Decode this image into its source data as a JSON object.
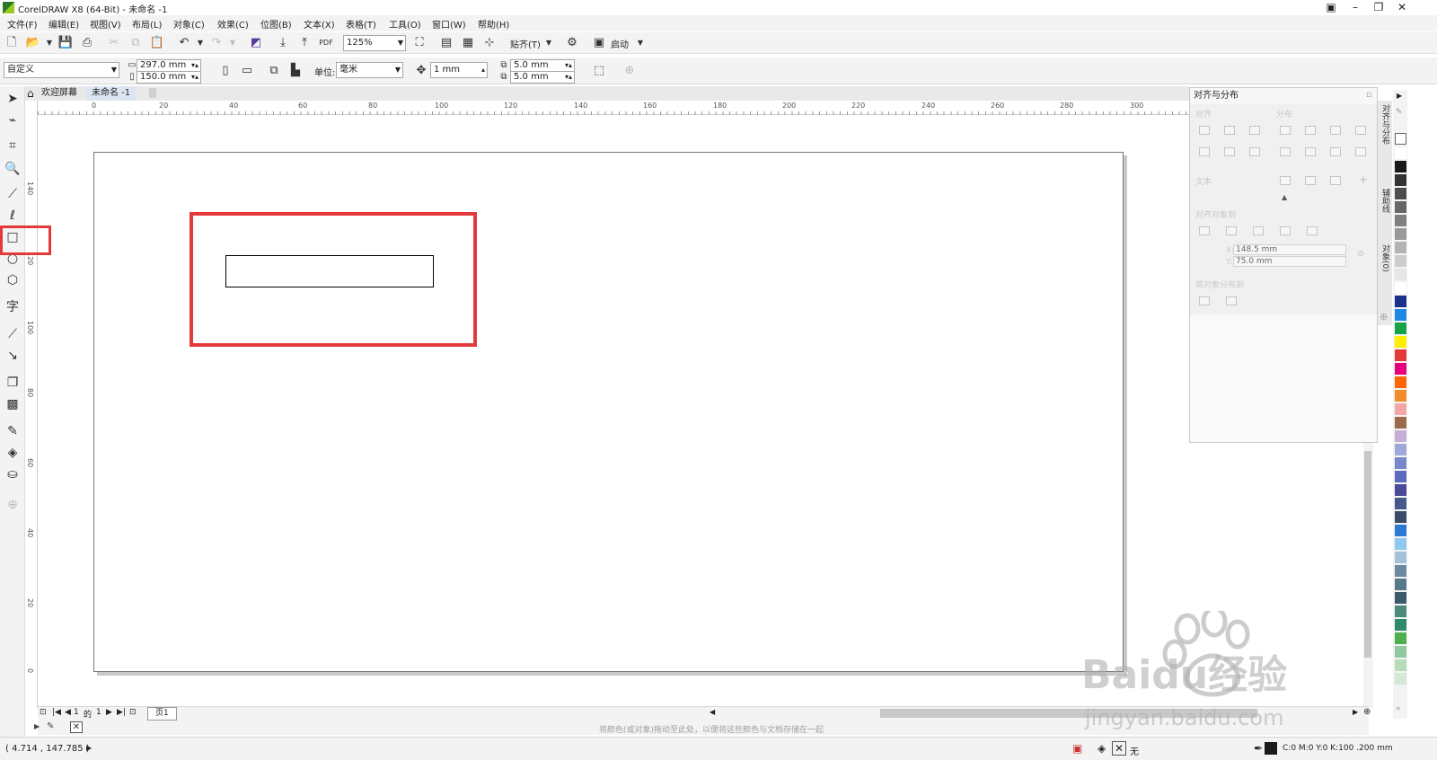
{
  "window": {
    "title": "CorelDRAW X8 (64-Bit) - 未命名 -1",
    "controls": [
      "minimize",
      "restore",
      "close"
    ]
  },
  "menubar": {
    "items": [
      "文件(F)",
      "编辑(E)",
      "视图(V)",
      "布局(L)",
      "对象(C)",
      "效果(C)",
      "位图(B)",
      "文本(X)",
      "表格(T)",
      "工具(O)",
      "窗口(W)",
      "帮助(H)"
    ]
  },
  "standard_toolbar": {
    "zoom_value": "125%",
    "snap_label": "贴齐(T)",
    "launch_label": "启动",
    "pdf_label": "PDF"
  },
  "property_bar": {
    "page_preset": "自定义",
    "page_width": "297.0 mm",
    "page_height": "150.0 mm",
    "units_label": "单位:",
    "units_value": "毫米",
    "nudge_value": "1 mm",
    "duplicate_x": "5.0 mm",
    "duplicate_y": "5.0 mm"
  },
  "doc_tabs": {
    "welcome": "欢迎屏幕",
    "document": "未命名 -1"
  },
  "ruler": {
    "h_labels": [
      "0",
      "20",
      "40",
      "60",
      "80",
      "100",
      "120",
      "140",
      "160",
      "180",
      "200",
      "220",
      "240",
      "260",
      "280",
      "300"
    ],
    "v_labels": [
      "140",
      "120",
      "100",
      "80",
      "60",
      "40",
      "20",
      "0"
    ]
  },
  "docker": {
    "title": "对齐与分布",
    "align_label": "对齐",
    "distribute_label": "分布",
    "text_label": "文本",
    "align_to_label": "对齐对象到",
    "x_label": "X:",
    "x_value": "148.5 mm",
    "y_label": "Y:",
    "y_value": "75.0 mm",
    "distribute_to_label": "将对象分布到",
    "side_tabs": [
      "对齐与分布",
      "辅助线",
      "对象(0)"
    ]
  },
  "page_navigator": {
    "current": "1",
    "of_label": "的",
    "total": "1",
    "page_tab": "页1"
  },
  "hint_text": "将颜色(或对象)拖动至此处，以便将这些颜色与文档存储在一起",
  "status": {
    "cursor_coords": "( 4.714 , 147.785 )",
    "fill_none": "无",
    "outline_info": "C:0 M:0 Y:0 K:100  .200 mm"
  },
  "palette_colors": [
    "#ffffff",
    "#1a1a1a",
    "#333333",
    "#4d4d4d",
    "#666666",
    "#808080",
    "#999999",
    "#b3b3b3",
    "#cccccc",
    "#e6e6e6",
    "#ffffff",
    "#1b2f8c",
    "#1e88e5",
    "#15a34a",
    "#ffee00",
    "#e53939",
    "#e6007e",
    "#ff6600",
    "#f28c28",
    "#f4a6a6",
    "#9b6a4a",
    "#c5b0d5",
    "#9fa8da",
    "#7986cb",
    "#5c6bc0",
    "#4a4a9a",
    "#455a8a",
    "#3a4a6a",
    "#2b7bd6",
    "#90c8f0",
    "#a5c2d8",
    "#6b8aa0",
    "#567a8c",
    "#3d5a6a",
    "#4a8a7a",
    "#2e8b6a",
    "#4caf50",
    "#8fc9a0",
    "#b8dbb8",
    "#d4e8d4"
  ],
  "watermark": {
    "brand": "Baidu经验",
    "url": "jingyan.baidu.com"
  }
}
